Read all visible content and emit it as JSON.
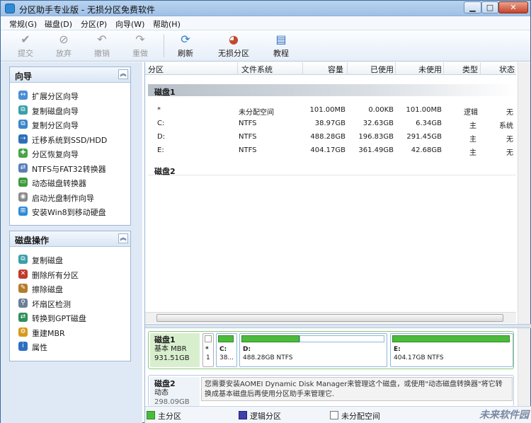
{
  "window": {
    "title": "分区助手专业版 - 无损分区免费软件"
  },
  "menu": [
    "常规(G)",
    "磁盘(D)",
    "分区(P)",
    "向导(W)",
    "帮助(H)"
  ],
  "toolbar": {
    "commit": "提交",
    "discard": "放弃",
    "undo": "撤销",
    "redo": "重做",
    "refresh": "刷新",
    "lossless": "无损分区",
    "tutorial": "教程"
  },
  "wizard_panel": {
    "title": "向导",
    "items": [
      "扩展分区向导",
      "复制磁盘向导",
      "复制分区向导",
      "迁移系统到SSD/HDD",
      "分区恢复向导",
      "NTFS与FAT32转换器",
      "动态磁盘转换器",
      "启动光盘制作向导",
      "安装Win8到移动硬盘"
    ]
  },
  "disk_panel": {
    "title": "磁盘操作",
    "items": [
      "复制磁盘",
      "删除所有分区",
      "擦除磁盘",
      "坏扇区检测",
      "转换到GPT磁盘",
      "重建MBR",
      "属性"
    ]
  },
  "table": {
    "columns": [
      "分区",
      "文件系统",
      "容量",
      "已使用",
      "未使用",
      "类型",
      "状态"
    ],
    "disk1_label": "磁盘1",
    "disk2_label": "磁盘2",
    "rows": [
      [
        "*",
        "未分配空间",
        "101.00MB",
        "0.00KB",
        "101.00MB",
        "逻辑",
        "无"
      ],
      [
        "C:",
        "NTFS",
        "38.97GB",
        "32.63GB",
        "6.34GB",
        "主",
        "系统"
      ],
      [
        "D:",
        "NTFS",
        "488.28GB",
        "196.83GB",
        "291.45GB",
        "主",
        "无"
      ],
      [
        "E:",
        "NTFS",
        "404.17GB",
        "361.49GB",
        "42.68GB",
        "主",
        "无"
      ]
    ]
  },
  "disk_map": {
    "disk1": {
      "name": "磁盘1",
      "type": "基本 MBR",
      "size": "931.51GB",
      "parts": [
        {
          "name": "*",
          "size": "1"
        },
        {
          "name": "C:",
          "size": "38..."
        },
        {
          "name": "D:",
          "size": "488.28GB NTFS"
        },
        {
          "name": "E:",
          "size": "404.17GB NTFS"
        }
      ]
    },
    "disk2": {
      "name": "磁盘2",
      "type": "动态",
      "size": "298.09GB",
      "message": "您需要安装AOMEI Dynamic Disk Manager来管理这个磁盘，或使用\"动态磁盘转换器\"将它转换成基本磁盘后再使用分区助手来管理它."
    }
  },
  "legend": {
    "primary": "主分区",
    "logical": "逻辑分区",
    "unallocated": "未分配空间"
  },
  "watermark": "未来软件园",
  "colors": {
    "primary": "#4cbb3d",
    "logical": "#3f3fb0",
    "accent": "#3b6a9e"
  }
}
